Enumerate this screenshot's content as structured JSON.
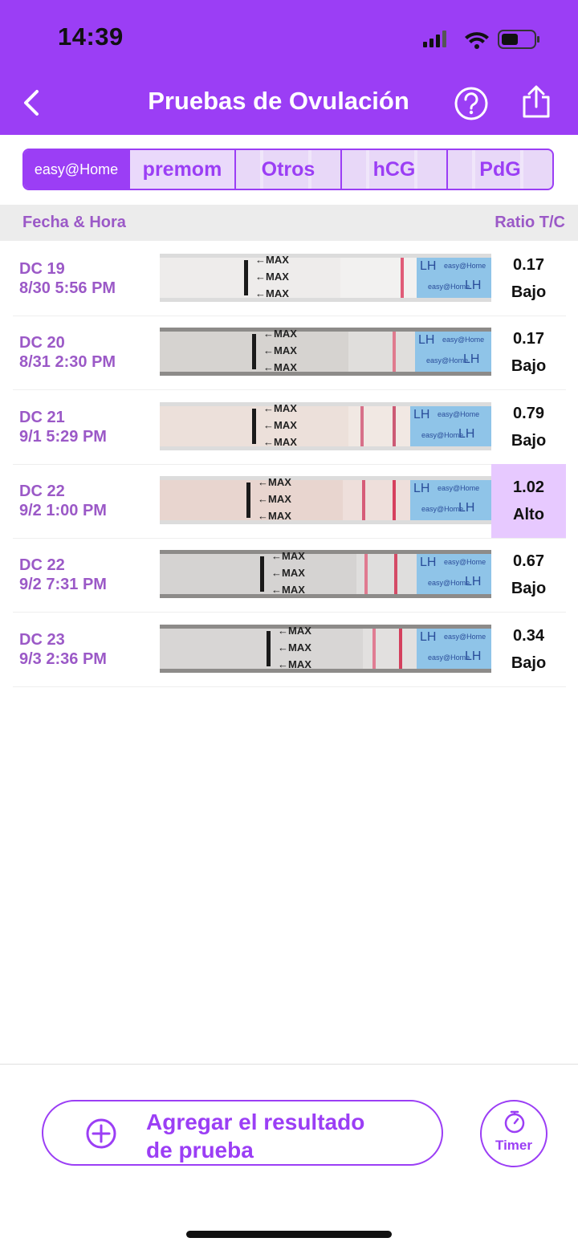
{
  "status_bar": {
    "time": "14:39"
  },
  "header": {
    "title": "Pruebas de Ovulación"
  },
  "brands": {
    "easy": "easy@Home",
    "premom": "premom",
    "tabs": [
      "Otros",
      "hCG",
      "PdG"
    ]
  },
  "columns": {
    "date": "Fecha & Hora",
    "ratio": "Ratio T/C"
  },
  "strip_text": {
    "max": "←MAX",
    "lh": "LH",
    "brand": "easy@Home"
  },
  "rows": [
    {
      "dc": "DC 19",
      "datetime": "8/30 5:56 PM",
      "ratio": "0.17",
      "level": "Bajo"
    },
    {
      "dc": "DC 20",
      "datetime": "8/31 2:30 PM",
      "ratio": "0.17",
      "level": "Bajo"
    },
    {
      "dc": "DC 21",
      "datetime": "9/1 5:29 PM",
      "ratio": "0.79",
      "level": "Bajo"
    },
    {
      "dc": "DC 22",
      "datetime": "9/2 1:00 PM",
      "ratio": "1.02",
      "level": "Alto"
    },
    {
      "dc": "DC 22",
      "datetime": "9/2 7:31 PM",
      "ratio": "0.67",
      "level": "Bajo"
    },
    {
      "dc": "DC 23",
      "datetime": "9/3 2:36 PM",
      "ratio": "0.34",
      "level": "Bajo"
    }
  ],
  "footer": {
    "add_line1": "Agregar el resultado",
    "add_line2": "de prueba",
    "timer": "Timer"
  },
  "colors": {
    "accent": "#9b3ef5",
    "label": "#9b59c7",
    "highlight": "#e7c9ff"
  }
}
